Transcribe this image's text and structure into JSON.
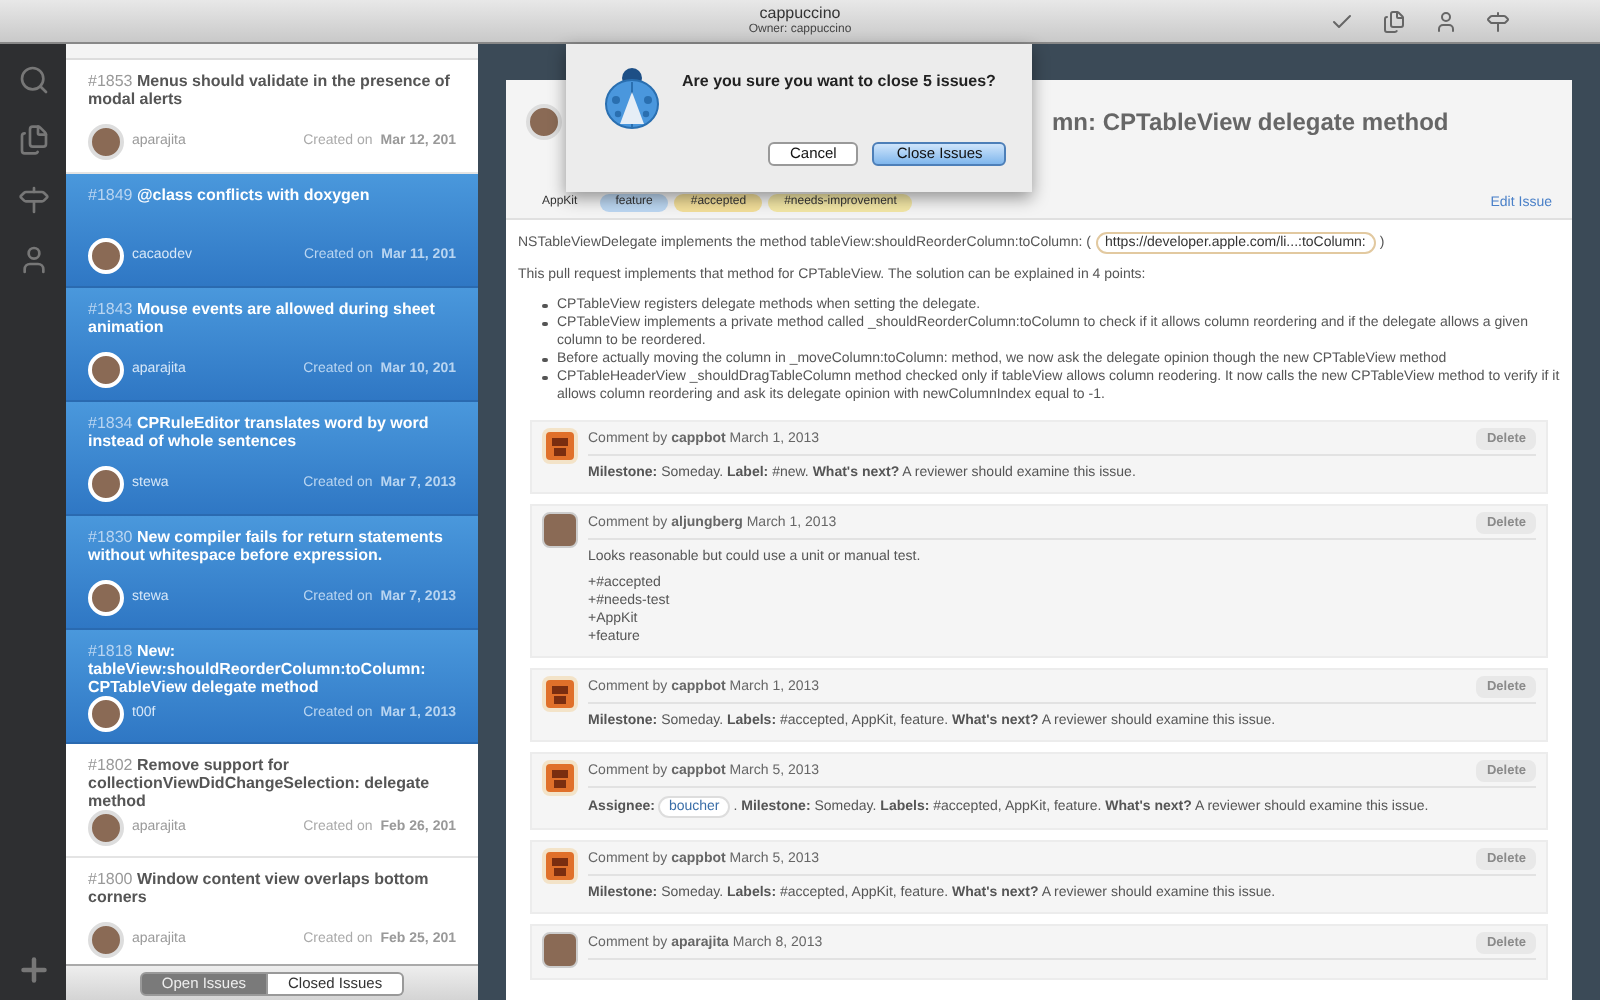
{
  "window": {
    "title": "cappuccino",
    "subtitle": "Owner: cappuccino"
  },
  "issues": [
    {
      "number": "#1853",
      "title": "Menus should validate in the presence of modal alerts",
      "author": "aparajita",
      "created_label": "Created on",
      "date": "Mar 12, 201",
      "selected": false
    },
    {
      "number": "#1849",
      "title": "@class conflicts with doxygen",
      "author": "cacaodev",
      "created_label": "Created on",
      "date": "Mar 11, 201",
      "selected": true
    },
    {
      "number": "#1843",
      "title": "Mouse events are allowed during sheet animation",
      "author": "aparajita",
      "created_label": "Created on",
      "date": "Mar 10, 201",
      "selected": true
    },
    {
      "number": "#1834",
      "title": "CPRuleEditor translates word by word instead of whole sentences",
      "author": "stewa",
      "created_label": "Created on",
      "date": "Mar 7, 2013",
      "selected": true
    },
    {
      "number": "#1830",
      "title": "New compiler fails for return statements without whitespace before expression.",
      "author": "stewa",
      "created_label": "Created on",
      "date": "Mar 7, 2013",
      "selected": true
    },
    {
      "number": "#1818",
      "title": "New: tableView:shouldReorderColumn:toColumn: CPTableView delegate method",
      "author": "t00f",
      "created_label": "Created on",
      "date": "Mar 1, 2013",
      "selected": true
    },
    {
      "number": "#1802",
      "title": "Remove support for collectionViewDidChangeSelection: delegate method",
      "author": "aparajita",
      "created_label": "Created on",
      "date": "Feb 26, 201",
      "selected": false
    },
    {
      "number": "#1800",
      "title": "Window content view overlaps bottom corners",
      "author": "aparajita",
      "created_label": "Created on",
      "date": "Feb 25, 201",
      "selected": false
    }
  ],
  "filter_tabs": [
    {
      "label": "Open Issues",
      "selected": true
    },
    {
      "label": "Closed Issues",
      "selected": false
    }
  ],
  "dialog": {
    "message": "Are you sure you want to close 5 issues?",
    "buttons": [
      {
        "label": "Cancel",
        "default": false
      },
      {
        "label": "Close Issues",
        "default": true
      }
    ]
  },
  "issue": {
    "title": "mn: CPTableView delegate method",
    "labels": [
      {
        "text": "AppKit",
        "color": "#f4f4f4"
      },
      {
        "text": "feature",
        "color": "#bcd7f2"
      },
      {
        "text": "#accepted",
        "color": "#f3df9a"
      },
      {
        "text": "#needs-improvement",
        "color": "#f3e7a6"
      }
    ],
    "edit_link": "Edit Issue",
    "intro": {
      "text": "NSTableViewDelegate implements the method tableView:shouldReorderColumn:toColumn: (",
      "link": "https://developer.apple.com/li...:toColumn:",
      "after": ")"
    },
    "summary": "This pull request implements that method for CPTableView. The solution can be explained in 4 points:",
    "points": [
      "CPTableView registers delegate methods when setting the delegate.",
      "CPTableView implements a private method called _shouldReorderColumn:toColumn to check if it allows column reordering and if the delegate allows a given column to be reordered.",
      "Before actually moving the column in _moveColumn:toColumn: method, we now ask the delegate opinion though the new CPTableView method",
      "CPTableHeaderView _shouldDragTableColumn method checked only if tableView allows column reodering. It now calls the new CPTableView method to verify if it allows column reordering and ask its delegate opinion with newColumnIndex equal to -1."
    ],
    "comments": [
      {
        "kind": "bot",
        "header": "Comment by **cappbot** March 1, 2013",
        "delete": "Delete",
        "body": [
          {
            "kind": "text",
            "text": "**Milestone:** Someday. **Label:** #new. **What's next?** A reviewer should examine this issue."
          }
        ]
      },
      {
        "kind": "user",
        "header": "Comment by **aljungberg** March 1, 2013",
        "delete": "Delete",
        "body": [
          {
            "kind": "text",
            "text": "Looks reasonable but could use a unit or manual test."
          },
          {
            "kind": "list",
            "lines": [
              "+#accepted",
              "+#needs-test",
              "+AppKit",
              "+feature"
            ]
          }
        ]
      },
      {
        "kind": "bot",
        "header": "Comment by **cappbot** March 1, 2013",
        "delete": "Delete",
        "body": [
          {
            "kind": "text",
            "text": "**Milestone:** Someday. **Labels:** #accepted, AppKit, feature. **What's next?** A reviewer should examine this issue."
          }
        ]
      },
      {
        "kind": "bot",
        "header": "Comment by **cappbot** March 5, 2013",
        "delete": "Delete",
        "body": [
          {
            "kind": "assignee",
            "label": "Assignee:",
            "name": "boucher",
            "rest": ". **Milestone:** Someday. **Labels:** #accepted, AppKit, feature. **What's next?** A reviewer should examine this issue."
          }
        ]
      },
      {
        "kind": "bot",
        "header": "Comment by **cappbot** March 5, 2013",
        "delete": "Delete",
        "body": [
          {
            "kind": "text",
            "text": "**Milestone:** Someday. **Labels:** #accepted, AppKit, feature. **What's next?** A reviewer should examine this issue."
          }
        ]
      },
      {
        "kind": "user",
        "header": "Comment by **aparajita** March 8, 2013",
        "delete": "Delete"
      }
    ]
  }
}
